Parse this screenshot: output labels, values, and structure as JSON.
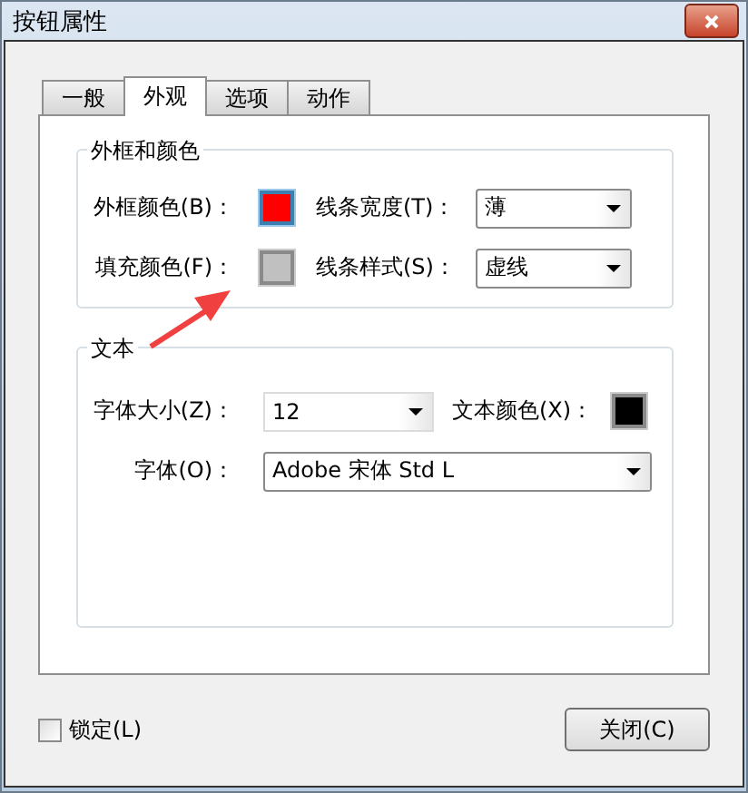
{
  "window": {
    "title": "按钮属性"
  },
  "tabs": [
    {
      "label": "一般",
      "selected": false
    },
    {
      "label": "外观",
      "selected": true
    },
    {
      "label": "选项",
      "selected": false
    },
    {
      "label": "动作",
      "selected": false
    }
  ],
  "border_group": {
    "title": "外框和颜色",
    "border_color": {
      "label": "外框颜色(B)：",
      "color": "#ff0000"
    },
    "line_width": {
      "label": "线条宽度(T)：",
      "value": "薄"
    },
    "fill_color": {
      "label": "填充颜色(F)：",
      "color": "#c0c0c0"
    },
    "line_style": {
      "label": "线条样式(S)：",
      "value": "虚线"
    }
  },
  "text_group": {
    "title": "文本",
    "font_size": {
      "label": "字体大小(Z)：",
      "value": "12"
    },
    "text_color": {
      "label": "文本颜色(X)：",
      "color": "#000000"
    },
    "font": {
      "label": "字体(O)：",
      "value": "Adobe 宋体 Std L"
    }
  },
  "lock": {
    "label": "锁定(L)",
    "checked": false
  },
  "close_button": {
    "label": "关闭(C)"
  }
}
